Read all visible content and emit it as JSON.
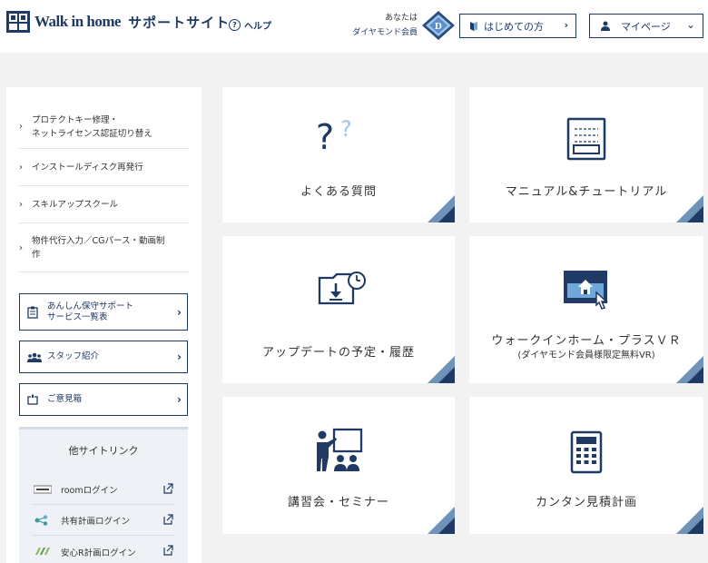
{
  "header": {
    "logo_text": "Walk in home",
    "site_title": "サポートサイト",
    "help_label": "ヘルプ",
    "member_line1": "あなたは",
    "member_line2": "ダイヤモンド会員",
    "start_button": "はじめての方",
    "mypage_button": "マイページ"
  },
  "sidebar": {
    "menu": [
      {
        "line1": "プロテクトキー修理・",
        "line2": "ネットライセンス認証切り替え"
      },
      {
        "line1": "インストールディスク再発行",
        "line2": ""
      },
      {
        "line1": "スキルアップスクール",
        "line2": ""
      },
      {
        "line1": "物件代行入力／CGパース・動画制",
        "line2": "作"
      }
    ],
    "buttons": [
      {
        "line1": "あんしん保守サポート",
        "line2": "サービス一覧表"
      },
      {
        "line1": "スタッフ紹介",
        "line2": ""
      },
      {
        "line1": "ご意見箱",
        "line2": ""
      }
    ],
    "others_title": "他サイトリンク",
    "links": [
      {
        "label": "roomログイン"
      },
      {
        "label": "共有計画ログイン"
      },
      {
        "label": "安心R計画ログイン"
      }
    ]
  },
  "cards": [
    {
      "label": "よくある質問",
      "sub": ""
    },
    {
      "label": "マニュアル&チュートリアル",
      "sub": ""
    },
    {
      "label": "アップデートの予定・履歴",
      "sub": ""
    },
    {
      "label": "ウォークインホーム・プラスＶＲ",
      "sub": "(ダイヤモンド会員様限定無料VR)"
    },
    {
      "label": "講習会・セミナー",
      "sub": ""
    },
    {
      "label": "カンタン見積計画",
      "sub": ""
    }
  ],
  "colors": {
    "primary": "#1f3a64",
    "accent": "#6fa8d9"
  }
}
